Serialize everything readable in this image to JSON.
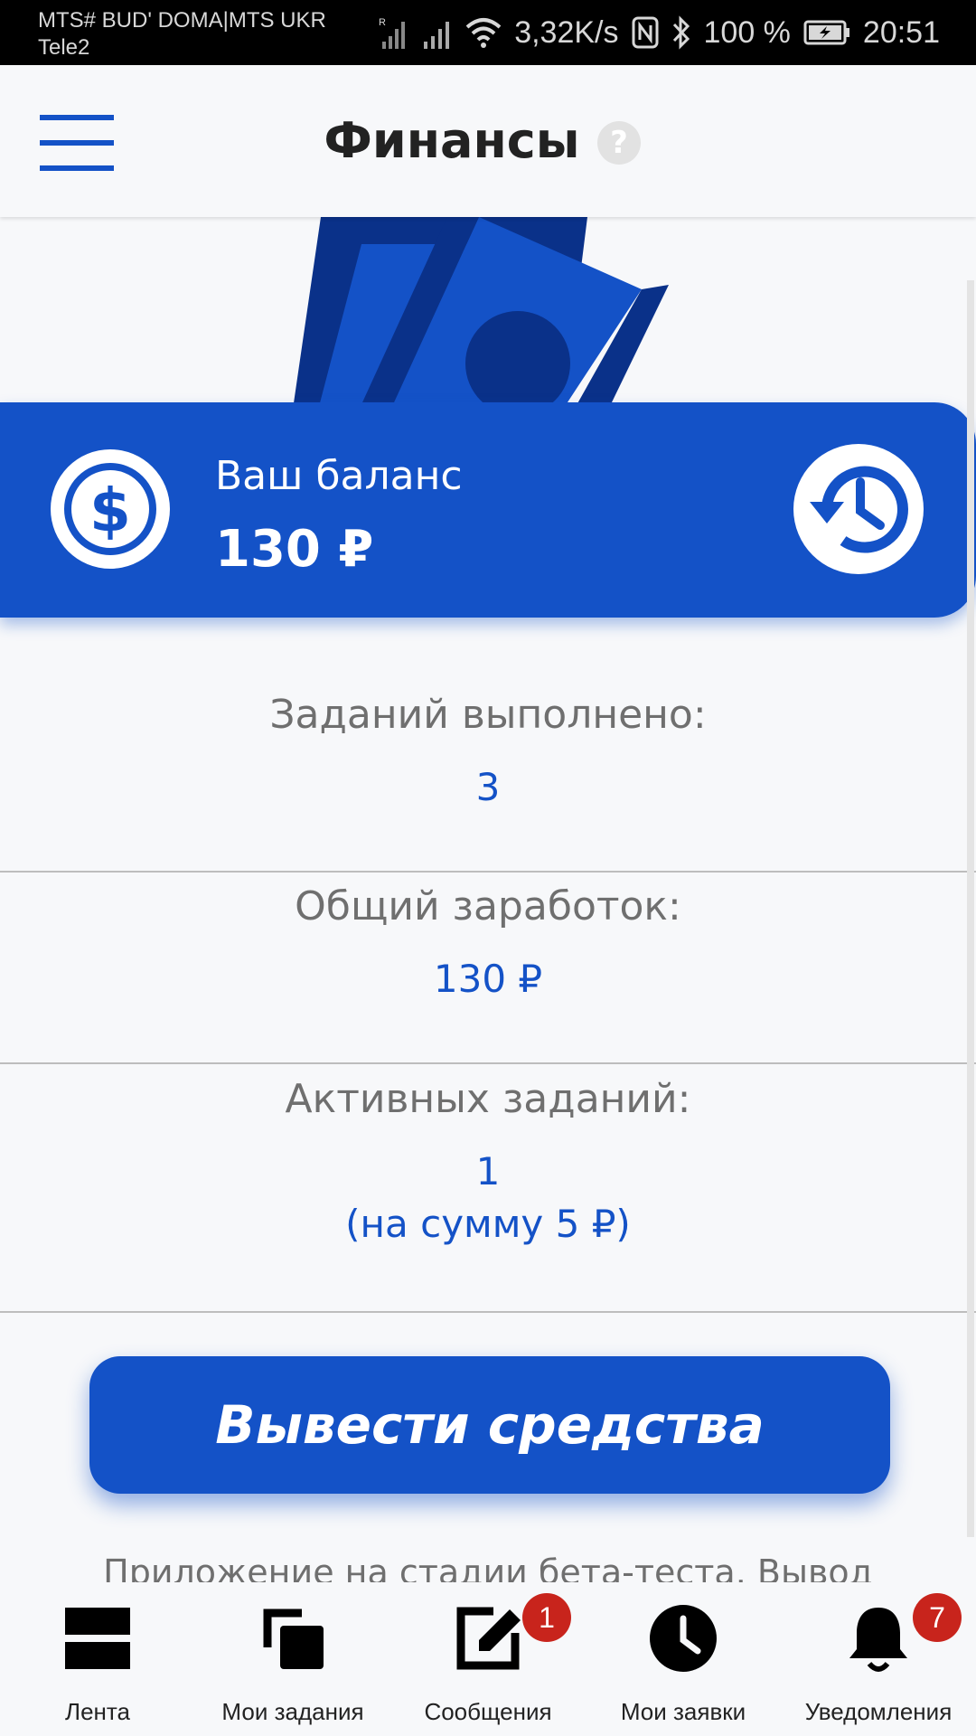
{
  "status_bar": {
    "carrier_line1": "MTS# BUD' DOMA|MTS UKR",
    "carrier_line2": "Tele2",
    "speed": "3,32K/s",
    "battery": "100 %",
    "time": "20:51"
  },
  "header": {
    "title": "Финансы",
    "help": "?"
  },
  "balance": {
    "label": "Ваш баланс",
    "value": "130 ₽"
  },
  "stats": [
    {
      "label": "Заданий выполнено:",
      "value": "3"
    },
    {
      "label": "Общий заработок:",
      "value": "130 ₽"
    },
    {
      "label": "Активных заданий:",
      "value": "1",
      "sub": "(на сумму 5 ₽)"
    }
  ],
  "withdraw_button": "Вывести средства",
  "beta_note": "Приложение на стадии бета-теста. Вывод",
  "bottom_nav": [
    {
      "label": "Лента",
      "icon": "feed-icon"
    },
    {
      "label": "Мои задания",
      "icon": "copy-icon"
    },
    {
      "label": "Сообщения",
      "icon": "edit-icon",
      "badge": "1"
    },
    {
      "label": "Мои заявки",
      "icon": "clock-icon"
    },
    {
      "label": "Уведомления",
      "icon": "bell-icon",
      "badge": "7"
    }
  ],
  "colors": {
    "accent": "#1452c7",
    "badge": "#c8241c",
    "background": "#f7f8fa"
  }
}
